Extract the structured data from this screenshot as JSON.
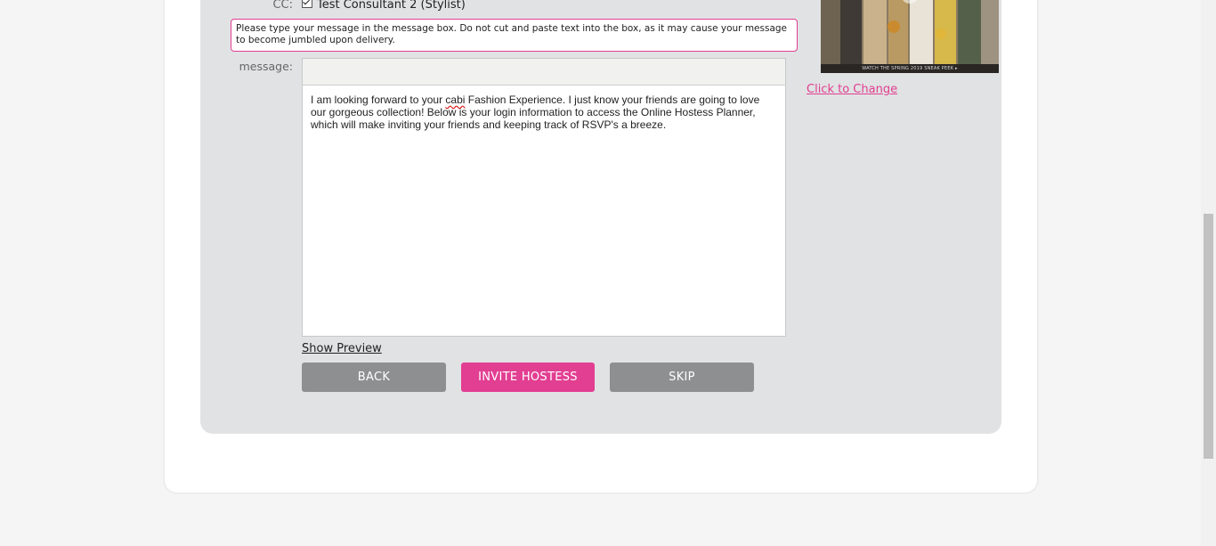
{
  "form": {
    "cc_label": "CC:",
    "cc_value": "Test Consultant 2 (Stylist)",
    "cc_checked": true,
    "notice": "Please type your message in the message box. Do not cut and paste text into the box, as it may cause your message to become jumbled upon delivery.",
    "message_label": "message:",
    "message_part1": "I am looking forward to your ",
    "message_spell": "cabi",
    "message_part2": " Fashion Experience. I just know your friends are going to love our gorgeous collection! Below is your login information to access the Online Hostess Planner, which will make inviting your friends and keeping track of RSVP's a breeze.",
    "show_preview": "Show Preview"
  },
  "buttons": {
    "back": "BACK",
    "invite": "INVITE HOSTESS",
    "skip": "SKIP"
  },
  "sidebar": {
    "video_caption": "WATCH THE SPRING 2019 SNEAK PEEK ▸",
    "change_link": "Click to Change"
  },
  "colors": {
    "accent": "#e23e92",
    "button_gray": "#8e8f91",
    "panel_bg": "#e1e2e4"
  }
}
